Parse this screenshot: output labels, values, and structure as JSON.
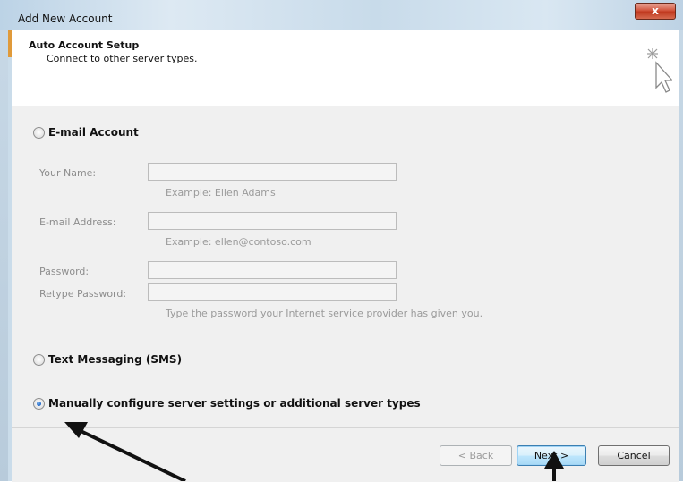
{
  "window": {
    "title": "Add New Account",
    "close_label": "x"
  },
  "header": {
    "title": "Auto Account Setup",
    "subtitle": "Connect to other server types."
  },
  "options": {
    "email": {
      "label": "E-mail Account",
      "selected": false,
      "fields": {
        "name": {
          "label": "Your Name:",
          "value": "",
          "hint": "Example: Ellen Adams"
        },
        "email": {
          "label": "E-mail Address:",
          "value": "",
          "hint": "Example: ellen@contoso.com"
        },
        "password": {
          "label": "Password:",
          "value": ""
        },
        "retype": {
          "label": "Retype Password:",
          "value": "",
          "hint": "Type the password your Internet service provider has given you."
        }
      }
    },
    "sms": {
      "label": "Text Messaging (SMS)",
      "selected": false
    },
    "manual": {
      "label": "Manually configure server settings or additional server types",
      "selected": true
    }
  },
  "footer": {
    "back_label": "< Back",
    "next_label": "Next >",
    "cancel_label": "Cancel"
  },
  "colors": {
    "accent": "#3c7fb1",
    "close": "#c0391f",
    "arrow": "#111111"
  },
  "icons": {
    "wizard": "cursor-sparkle-icon"
  }
}
